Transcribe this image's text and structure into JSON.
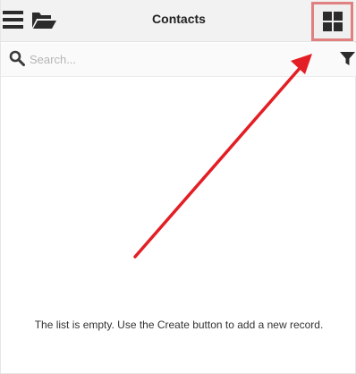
{
  "header": {
    "title": "Contacts",
    "menu_icon": "hamburger-menu-icon",
    "folder_icon": "folder-open-icon",
    "view_toggle_icon": "grid-view-icon"
  },
  "search": {
    "placeholder": "Search...",
    "value": "",
    "icon": "search-icon",
    "filter_icon": "filter-icon"
  },
  "list": {
    "empty_message": "The list is empty. Use the Create button to add a new record."
  },
  "colors": {
    "header_bg": "#f2f2f2",
    "highlight_box": "#e08080",
    "annotation_arrow": "#e31e24",
    "icon": "#2b2b2b"
  }
}
